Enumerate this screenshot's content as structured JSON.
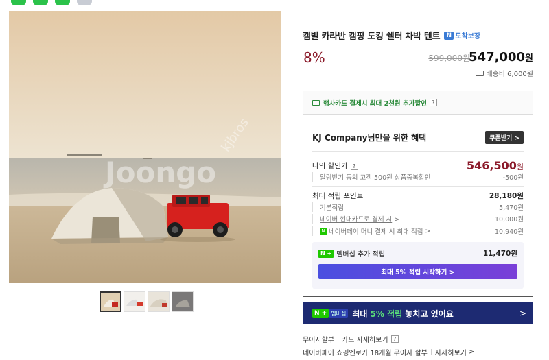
{
  "product": {
    "title": "캠빌 카라반 캠핑 도킹 쉘터 차박 텐트",
    "arrival_badge": "도착보장",
    "discount_rate": "8%",
    "original_price": "599,000원",
    "sale_price": "547,000",
    "sale_price_unit": "원",
    "shipping": "배송비 6,000원"
  },
  "card_promo": {
    "text": "행사카드 결제시 최대 2천원 추가할인",
    "help": "?"
  },
  "benefit": {
    "heading": "KJ Company님만을 위한 혜택",
    "coupon_button": "쿠폰받기 >",
    "my_price_label": "나의 할인가",
    "my_price": "546,500",
    "my_price_unit": "원",
    "alarm_note": "알림받기 등의 고객 500원 상품중복할인",
    "alarm_discount": "-500원",
    "points_label": "최대 적립 포인트",
    "points_total": "28,180원",
    "basic_label": "기본적립",
    "basic_value": "5,470원",
    "hyundai_label": "네이버 현대카드로 결제 시",
    "hyundai_value": "10,000원",
    "npay_label": "네이버페이 머니 결제 시 최대 적립",
    "npay_value": "10,940원",
    "member_logo": "N +",
    "member_label": "멤버십 추가 적립",
    "member_value": "11,470원",
    "member_button": "최대 5% 적립 시작하기 >"
  },
  "banner": {
    "logo_n": "N +",
    "logo_m": "멤버십",
    "text_pre": "최대 ",
    "text_hl": "5% 적립",
    "text_post": " 놓치고 있어요",
    "chevron": ">"
  },
  "footer": {
    "installment": "무이자할부",
    "card_detail": "카드 자세히보기",
    "npay_installment": "네이버페이 쇼핑엔로카 18개월 무이자 할부",
    "detail": "자세히보기"
  },
  "colors": {
    "discount_red": "#8b1a2a",
    "naver_green": "#1ec800",
    "banner_navy": "#1d2a72"
  }
}
